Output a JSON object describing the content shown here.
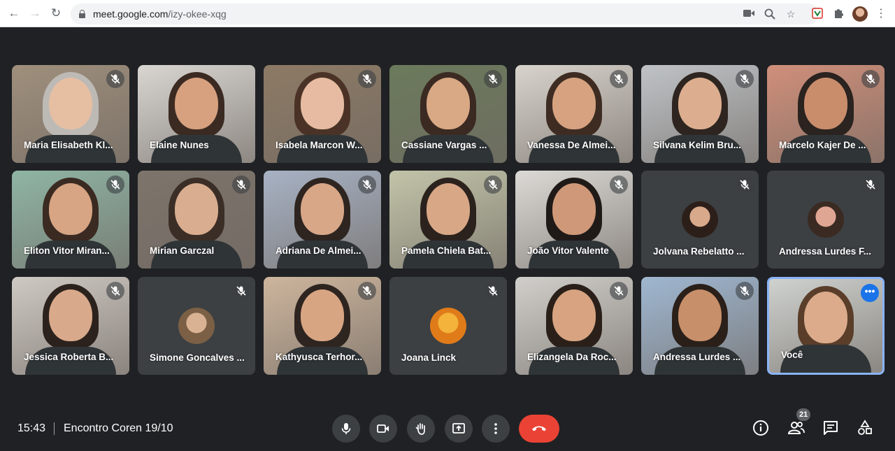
{
  "browser": {
    "url_host": "meet.google.com",
    "url_path": "/izy-okee-xqg"
  },
  "participants": [
    {
      "name": "Maria Elisabeth Kl...",
      "video": true,
      "muted": true,
      "bg": "#9f8f7c",
      "skin": "#e6bfa3",
      "hair": "#bdbab6"
    },
    {
      "name": "Elaine Nunes",
      "video": true,
      "muted": false,
      "bg": "#d9d6d2",
      "skin": "#d7a07e",
      "hair": "#3a2a22"
    },
    {
      "name": "Isabela Marcon W...",
      "video": true,
      "muted": true,
      "bg": "#8d7a65",
      "skin": "#e6bba1",
      "hair": "#4a3326"
    },
    {
      "name": "Cassiane Vargas ...",
      "video": true,
      "muted": true,
      "bg": "#6b7a5c",
      "skin": "#d9a884",
      "hair": "#3b2a22"
    },
    {
      "name": "Vanessa De Almei...",
      "video": true,
      "muted": true,
      "bg": "#d8d3cc",
      "skin": "#d6a280",
      "hair": "#3e2c22"
    },
    {
      "name": "Silvana Kelim Bru...",
      "video": true,
      "muted": true,
      "bg": "#bfc3c7",
      "skin": "#dcae8f",
      "hair": "#2e2520"
    },
    {
      "name": "Marcelo Kajer De ...",
      "video": true,
      "muted": true,
      "bg": "#d08f7a",
      "skin": "#c98d6c",
      "hair": "#2a2320"
    },
    {
      "name": "Eliton Vitor Miran...",
      "video": true,
      "muted": true,
      "bg": "#8fb5a5",
      "skin": "#d7a583",
      "hair": "#3a2a22"
    },
    {
      "name": "Mirian Garczal",
      "video": true,
      "muted": true,
      "bg": "#7d746b",
      "skin": "#d9ad8f",
      "hair": "#3b2e26"
    },
    {
      "name": "Adriana De Almei...",
      "video": true,
      "muted": true,
      "bg": "#a7b2c4",
      "skin": "#d8a788",
      "hair": "#2e2520"
    },
    {
      "name": "Pamela Chiela Bat...",
      "video": true,
      "muted": true,
      "bg": "#c2c4a9",
      "skin": "#d8a786",
      "hair": "#2c221d"
    },
    {
      "name": "João Vitor Valente",
      "video": true,
      "muted": true,
      "bg": "#dcdad6",
      "skin": "#cf9878",
      "hair": "#1f1a18"
    },
    {
      "name": "Jolvana Rebelatto ...",
      "video": false,
      "muted": true,
      "bg": "#3c4043",
      "skin": "#d9a98b",
      "hair": "#2c1f19"
    },
    {
      "name": "Andressa Lurdes F...",
      "video": false,
      "muted": true,
      "bg": "#3c4043",
      "skin": "#e0a694",
      "hair": "#3a2a22"
    },
    {
      "name": "Jessica Roberta B...",
      "video": true,
      "muted": true,
      "bg": "#cfc9c3",
      "skin": "#d9a98b",
      "hair": "#2c221d"
    },
    {
      "name": "Simone Goncalves ...",
      "video": false,
      "muted": true,
      "bg": "#3c4043",
      "skin": "#d9b293",
      "hair": "#7b6045"
    },
    {
      "name": "Kathyusca Terhor...",
      "video": true,
      "muted": true,
      "bg": "#cdb59d",
      "skin": "#d8a583",
      "hair": "#2e2520"
    },
    {
      "name": "Joana Linck",
      "video": false,
      "muted": true,
      "bg": "#3c4043",
      "skin": "#f4b33a",
      "hair": "#e07b1a"
    },
    {
      "name": "Elizangela Da Roc...",
      "video": true,
      "muted": true,
      "bg": "#d1cfcb",
      "skin": "#d7a380",
      "hair": "#2a2019"
    },
    {
      "name": "Andressa Lurdes ...",
      "video": true,
      "muted": true,
      "bg": "#9fb7d1",
      "skin": "#c88f6b",
      "hair": "#2a2019"
    },
    {
      "name": "Você",
      "video": true,
      "muted": false,
      "self": true,
      "bg": "#cfd2cf",
      "skin": "#dbab8c",
      "hair": "#5a3e2a"
    }
  ],
  "bottom": {
    "time": "15:43",
    "meeting_title": "Encontro Coren 19/10",
    "participant_count": "21"
  },
  "colors": {
    "background": "#202124",
    "tile": "#3c4043",
    "leave": "#ea4335",
    "self_border": "#8ab4f8",
    "more": "#1a73e8"
  }
}
